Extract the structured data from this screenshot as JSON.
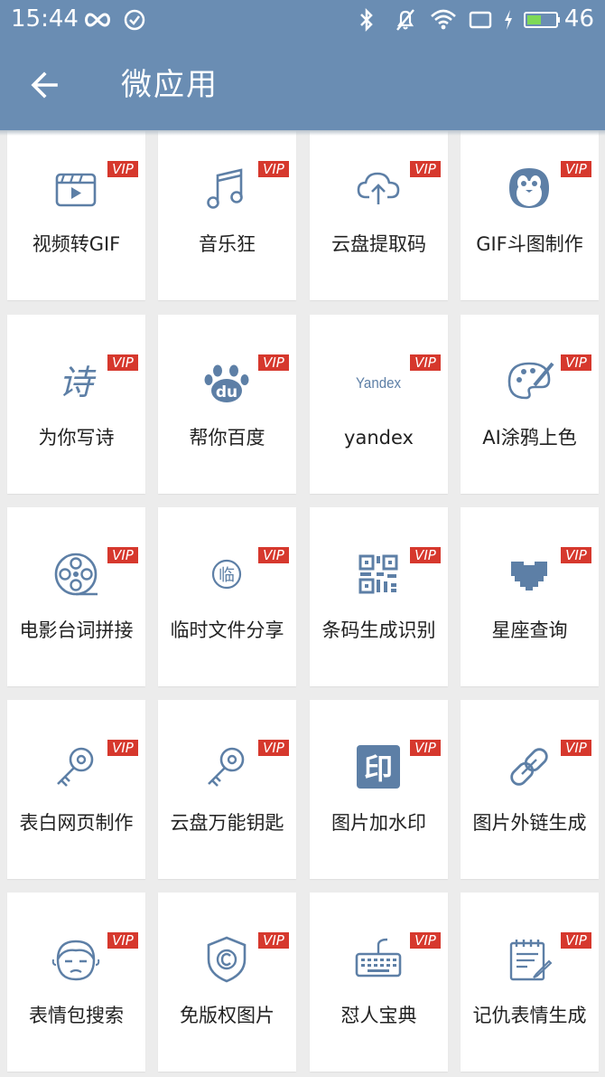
{
  "status_bar": {
    "time": "15:44",
    "battery_level": "46",
    "icons": [
      "infinity-icon",
      "check-circle-icon",
      "bluetooth-icon",
      "mute-icon",
      "wifi-icon",
      "screen-icon",
      "charging-icon",
      "battery-icon"
    ]
  },
  "app_bar": {
    "title": "微应用",
    "back_icon": "arrow-left-icon"
  },
  "colors": {
    "primary": "#6a8db3",
    "vip_badge": "#d6382d",
    "icon_tint": "#5d7fa6",
    "background": "#ececec"
  },
  "apps": [
    {
      "label": "视频转GIF",
      "badge": "VIP",
      "icon": "video-icon"
    },
    {
      "label": "音乐狂",
      "badge": "VIP",
      "icon": "music-note-icon"
    },
    {
      "label": "云盘提取码",
      "badge": "VIP",
      "icon": "cloud-upload-icon"
    },
    {
      "label": "GIF斗图制作",
      "badge": "VIP",
      "icon": "penguin-icon"
    },
    {
      "label": "为你写诗",
      "badge": "VIP",
      "icon": "poem-icon",
      "icon_text": "诗"
    },
    {
      "label": "帮你百度",
      "badge": "VIP",
      "icon": "baidu-paw-icon",
      "icon_text": "du"
    },
    {
      "label": "yandex",
      "badge": "VIP",
      "icon": "yandex-logo-icon",
      "icon_text": "Yandex"
    },
    {
      "label": "AI涂鸦上色",
      "badge": "VIP",
      "icon": "palette-icon"
    },
    {
      "label": "电影台词拼接",
      "badge": "VIP",
      "icon": "film-reel-icon"
    },
    {
      "label": "临时文件分享",
      "badge": "VIP",
      "icon": "temp-file-icon",
      "icon_text": "临"
    },
    {
      "label": "条码生成识别",
      "badge": "VIP",
      "icon": "qr-code-icon"
    },
    {
      "label": "星座查询",
      "badge": "VIP",
      "icon": "pixel-heart-icon"
    },
    {
      "label": "表白网页制作",
      "badge": "VIP",
      "icon": "key-icon"
    },
    {
      "label": "云盘万能钥匙",
      "badge": "VIP",
      "icon": "key-icon"
    },
    {
      "label": "图片加水印",
      "badge": "VIP",
      "icon": "stamp-icon",
      "icon_text": "印"
    },
    {
      "label": "图片外链生成",
      "badge": "VIP",
      "icon": "link-icon"
    },
    {
      "label": "表情包搜索",
      "badge": "VIP",
      "icon": "face-icon"
    },
    {
      "label": "免版权图片",
      "badge": "VIP",
      "icon": "copyright-shield-icon"
    },
    {
      "label": "怼人宝典",
      "badge": "VIP",
      "icon": "keyboard-icon"
    },
    {
      "label": "记仇表情生成",
      "badge": "VIP",
      "icon": "notepad-icon"
    }
  ]
}
